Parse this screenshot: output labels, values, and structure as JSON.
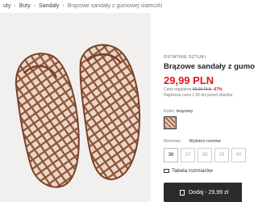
{
  "breadcrumb": {
    "items": [
      "uty",
      "Buty",
      "Sandały",
      "Brązowe sandały z gumowej siateczki"
    ],
    "separator": "›"
  },
  "product": {
    "badge": "OSTATNIE SZTUKI",
    "title": "Brązowe sandały z gumo",
    "price": "29,99 PLN",
    "regular_price_label": "Cena regularna",
    "regular_price": "89,99 PLN",
    "discount": "-67%",
    "lowest_price_note": "Najniższa cena z 30 dni przed obniżką",
    "color_label": "Kolor",
    "color_value": "brązowy",
    "size_label": "Rozmiar",
    "size_placeholder": "Wybierz rozmiar",
    "sizes": [
      "36",
      "37",
      "38",
      "39",
      "40"
    ],
    "selected_size": "36",
    "size_table_label": "Tabela rozmiarów",
    "add_button_label": "Dodaj - 29,99 zł"
  },
  "colors": {
    "price": "#e0161d",
    "button_bg": "#2b2b2b",
    "image_bg": "#f1f0ef",
    "shoe": "#9a5a3c"
  }
}
